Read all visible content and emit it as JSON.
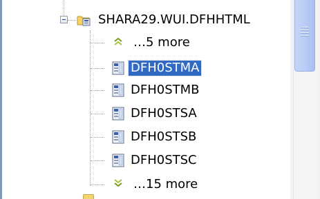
{
  "tree": {
    "parent": {
      "label": "SHARA29.WUI.DFHHTML",
      "icon": "package-folder-icon",
      "expanded": true
    },
    "more_above": {
      "label": "…5 more",
      "icon": "chevron-up-double-icon"
    },
    "items": [
      {
        "label": "DFH0STMA",
        "icon": "html-file-icon",
        "selected": true
      },
      {
        "label": "DFH0STMB",
        "icon": "html-file-icon",
        "selected": false
      },
      {
        "label": "DFH0STSA",
        "icon": "html-file-icon",
        "selected": false
      },
      {
        "label": "DFH0STSB",
        "icon": "html-file-icon",
        "selected": false
      },
      {
        "label": "DFH0STSC",
        "icon": "html-file-icon",
        "selected": false
      }
    ],
    "more_below": {
      "label": "…15 more",
      "icon": "chevron-down-double-icon"
    }
  },
  "colors": {
    "selection": "#316ac5",
    "chevron": "#7a9a1a",
    "scroll_thumb": "#b9cdf6"
  }
}
